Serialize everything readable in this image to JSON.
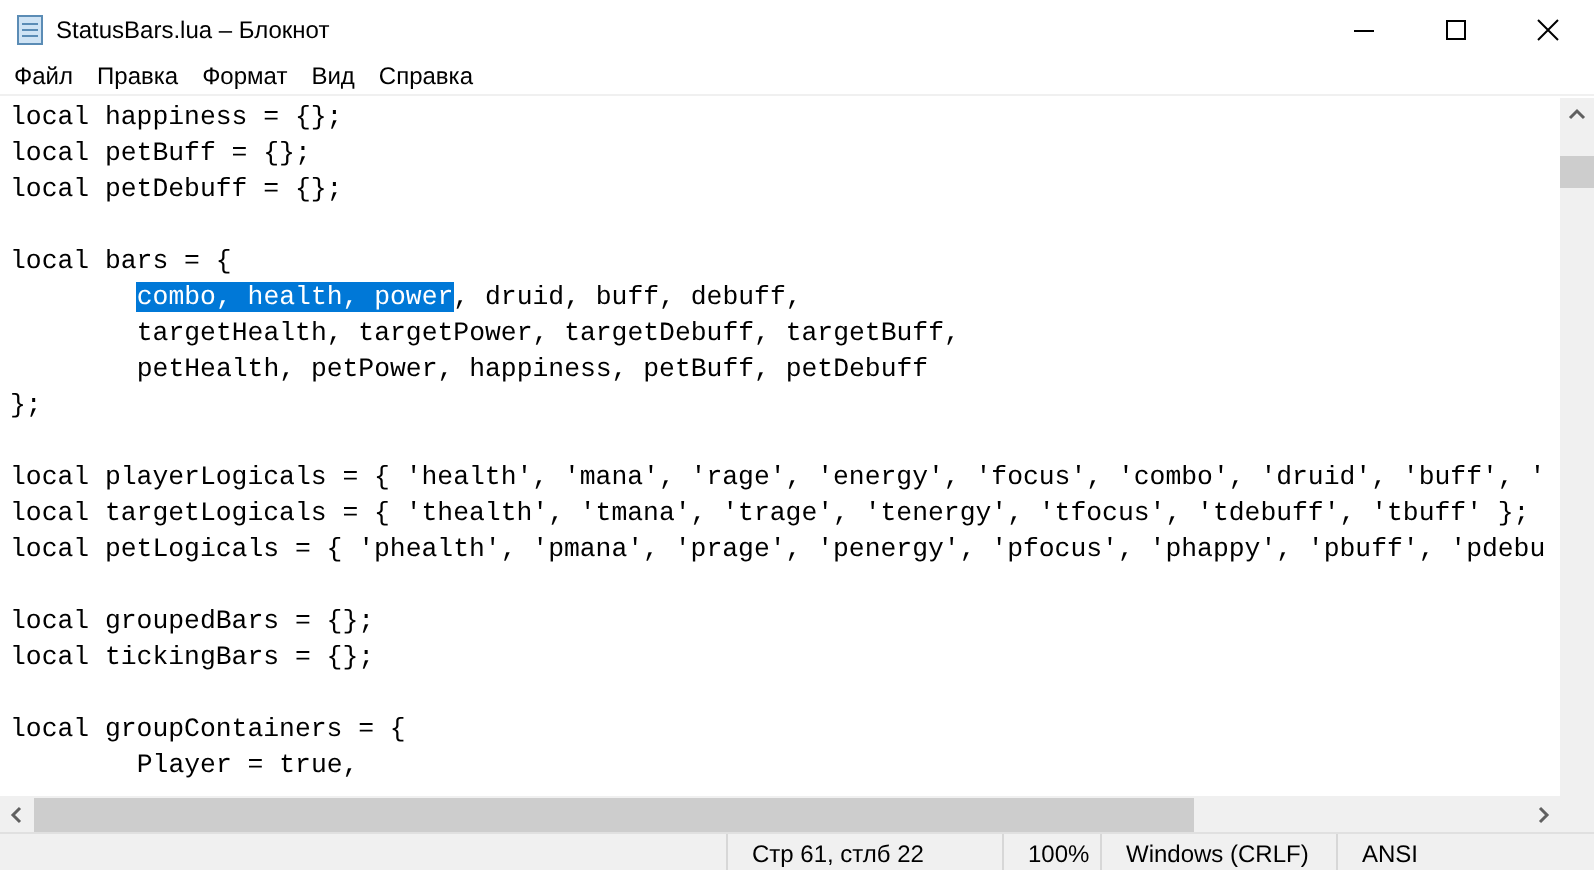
{
  "window": {
    "title": "StatusBars.lua – Блокнот"
  },
  "menu": [
    "Файл",
    "Правка",
    "Формат",
    "Вид",
    "Справка"
  ],
  "editor": {
    "lines": [
      {
        "kind": "code",
        "segments": [
          {
            "text": "local happiness = {};",
            "selected": false
          }
        ]
      },
      {
        "kind": "code",
        "segments": [
          {
            "text": "local petBuff = {};",
            "selected": false
          }
        ]
      },
      {
        "kind": "code",
        "segments": [
          {
            "text": "local petDebuff = {};",
            "selected": false
          }
        ]
      },
      {
        "kind": "blank"
      },
      {
        "kind": "code",
        "segments": [
          {
            "text": "local bars = {",
            "selected": false
          }
        ]
      },
      {
        "kind": "code",
        "indented": true,
        "segments": [
          {
            "text": "combo, health, power",
            "selected": true
          },
          {
            "text": ", druid, buff, debuff,",
            "selected": false
          }
        ]
      },
      {
        "kind": "code",
        "indented": true,
        "segments": [
          {
            "text": "targetHealth, targetPower, targetDebuff, targetBuff,",
            "selected": false
          }
        ]
      },
      {
        "kind": "code",
        "indented": true,
        "segments": [
          {
            "text": "petHealth, petPower, happiness, petBuff, petDebuff",
            "selected": false
          }
        ]
      },
      {
        "kind": "code",
        "segments": [
          {
            "text": "};",
            "selected": false
          }
        ]
      },
      {
        "kind": "blank"
      },
      {
        "kind": "code",
        "segments": [
          {
            "text": "local playerLogicals = { 'health', 'mana', 'rage', 'energy', 'focus', 'combo', 'druid', 'buff', '",
            "selected": false
          }
        ]
      },
      {
        "kind": "code",
        "segments": [
          {
            "text": "local targetLogicals = { 'thealth', 'tmana', 'trage', 'tenergy', 'tfocus', 'tdebuff', 'tbuff' };",
            "selected": false
          }
        ]
      },
      {
        "kind": "code",
        "segments": [
          {
            "text": "local petLogicals = { 'phealth', 'pmana', 'prage', 'penergy', 'pfocus', 'phappy', 'pbuff', 'pdebu",
            "selected": false
          }
        ]
      },
      {
        "kind": "blank"
      },
      {
        "kind": "code",
        "segments": [
          {
            "text": "local groupedBars = {};",
            "selected": false
          }
        ]
      },
      {
        "kind": "code",
        "segments": [
          {
            "text": "local tickingBars = {};",
            "selected": false
          }
        ]
      },
      {
        "kind": "blank"
      },
      {
        "kind": "code",
        "segments": [
          {
            "text": "local groupContainers = {",
            "selected": false
          }
        ]
      },
      {
        "kind": "code",
        "indented": true,
        "segments": [
          {
            "text": "Player = true,",
            "selected": false
          }
        ]
      }
    ]
  },
  "status_bar": [
    "Стр 61, стлб 22",
    "100%",
    "Windows (CRLF)",
    "ANSI"
  ]
}
